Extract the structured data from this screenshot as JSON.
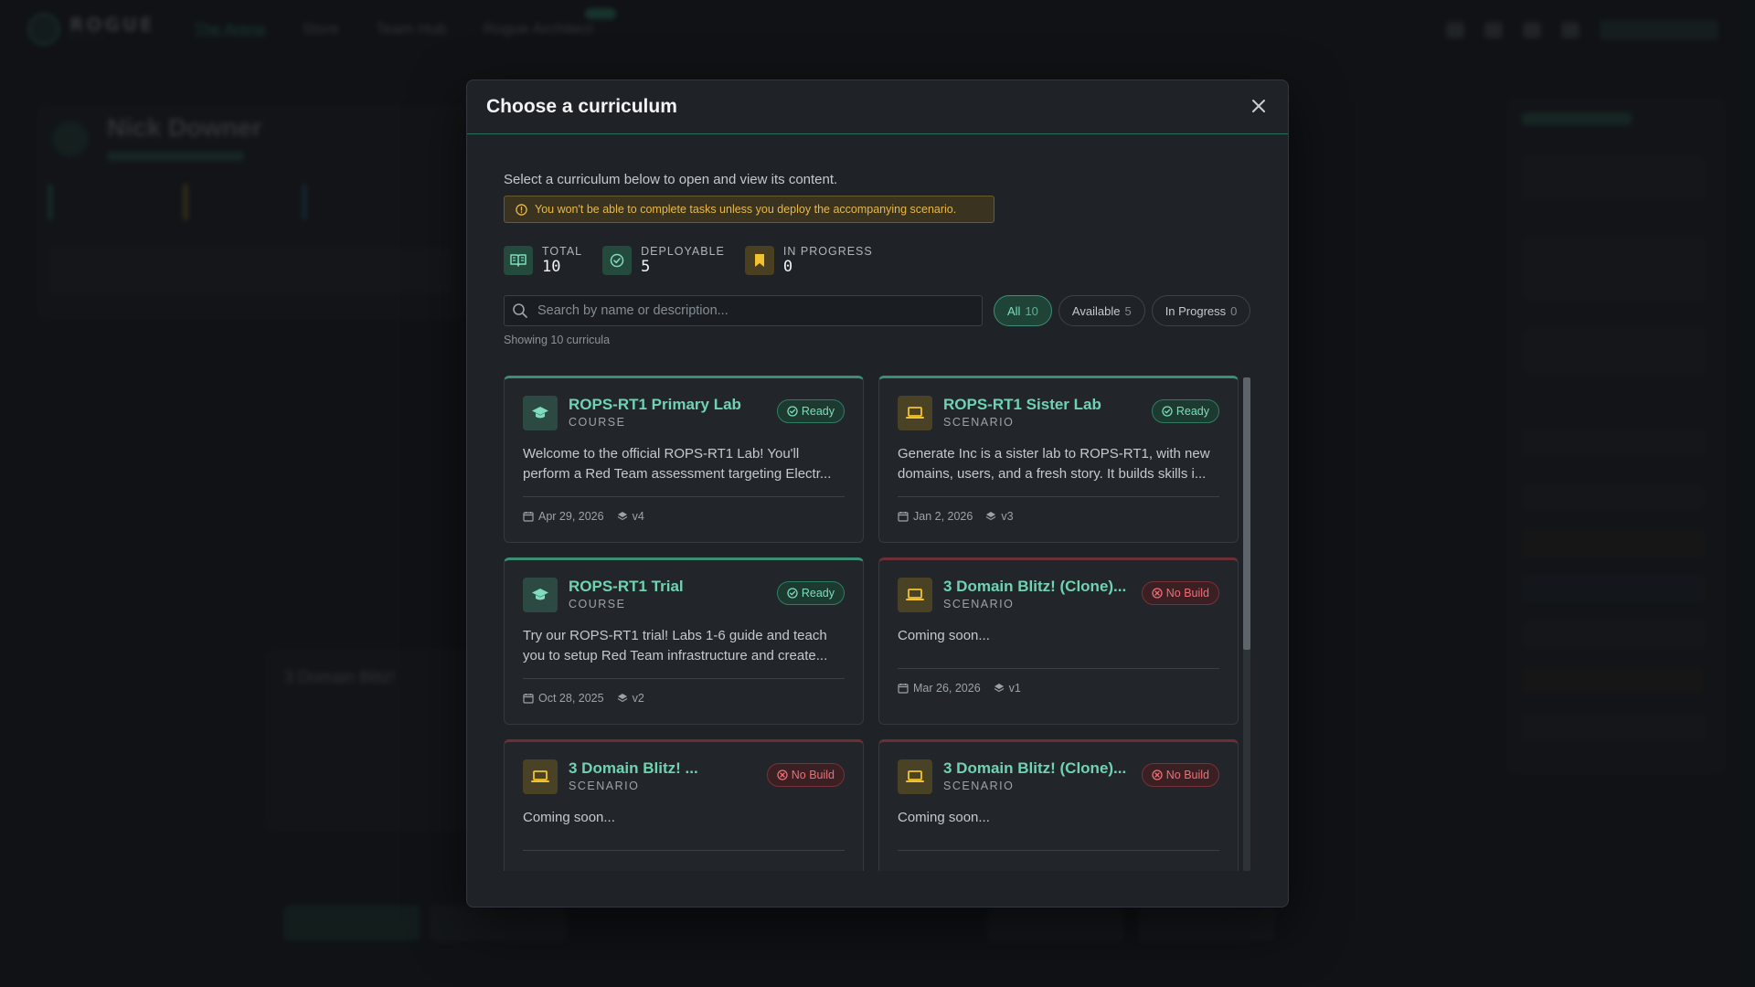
{
  "background": {
    "brand": "ROGUE",
    "nav": [
      "The Arena",
      "Store",
      "Team Hub",
      "Rogue Architect"
    ],
    "profile_name": "Nick Downer",
    "project_name": "3 Domain Blitz!"
  },
  "modal": {
    "title": "Choose a curriculum",
    "intro": "Select a curriculum below to open and view its content.",
    "warning": "You won't be able to complete tasks unless you deploy the accompanying scenario.",
    "stats": [
      {
        "label": "TOTAL",
        "value": "10",
        "icon": "book-icon",
        "color": "green"
      },
      {
        "label": "DEPLOYABLE",
        "value": "5",
        "icon": "check-circle-icon",
        "color": "green"
      },
      {
        "label": "IN PROGRESS",
        "value": "0",
        "icon": "bookmark-icon",
        "color": "yellow"
      }
    ],
    "search_placeholder": "Search by name or description...",
    "filters": [
      {
        "label": "All",
        "count": "10",
        "active": true
      },
      {
        "label": "Available",
        "count": "5",
        "active": false
      },
      {
        "label": "In Progress",
        "count": "0",
        "active": false
      }
    ],
    "showing": "Showing 10 curricula",
    "cards": [
      {
        "title": "ROPS-RT1 Primary Lab",
        "type": "COURSE",
        "status": "Ready",
        "desc": "Welcome to the official ROPS-RT1 Lab! You'll perform a Red Team assessment targeting Electr...",
        "date": "Apr 29, 2026",
        "version": "v4"
      },
      {
        "title": "ROPS-RT1 Sister Lab",
        "type": "SCENARIO",
        "status": "Ready",
        "desc": "Generate Inc is a sister lab to ROPS-RT1, with new domains, users, and a fresh story. It builds skills i...",
        "date": "Jan 2, 2026",
        "version": "v3"
      },
      {
        "title": "ROPS-RT1 Trial",
        "type": "COURSE",
        "status": "Ready",
        "desc": "Try our ROPS-RT1 trial! Labs 1-6 guide and teach you to setup Red Team infrastructure and create...",
        "date": "Oct 28, 2025",
        "version": "v2"
      },
      {
        "title": "3 Domain Blitz! (Clone)...",
        "type": "SCENARIO",
        "status": "No Build",
        "desc": "Coming soon...",
        "date": "Mar 26, 2026",
        "version": "v1"
      },
      {
        "title": "3 Domain Blitz! ...",
        "type": "SCENARIO",
        "status": "No Build",
        "desc": "Coming soon...",
        "date": "",
        "version": ""
      },
      {
        "title": "3 Domain Blitz! (Clone)...",
        "type": "SCENARIO",
        "status": "No Build",
        "desc": "Coming soon...",
        "date": "",
        "version": ""
      }
    ]
  },
  "colors": {
    "accent": "#3b8f74",
    "accent_text": "#6fd3b2",
    "warning": "#e7b84a",
    "danger": "#ef6e77"
  }
}
